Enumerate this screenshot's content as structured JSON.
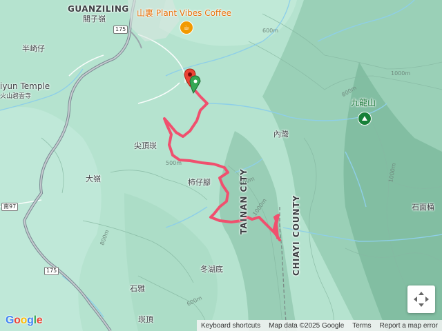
{
  "map": {
    "place_labels": [
      {
        "id": "guanziling-en",
        "text": "GUANZILING"
      },
      {
        "id": "guanziling-zh",
        "text": "關子嶺"
      },
      {
        "id": "banqizi",
        "text": "半崎仔"
      },
      {
        "id": "biyun-temple-en",
        "text": "iyun Temple"
      },
      {
        "id": "biyun-temple-zh",
        "text": "火山碧雲寺"
      },
      {
        "id": "jianding",
        "text": "尖頂崁"
      },
      {
        "id": "dalin",
        "text": "大嶺"
      },
      {
        "id": "shizijiao",
        "text": "柿仔腳"
      },
      {
        "id": "neiwan",
        "text": "內灣"
      },
      {
        "id": "donghudi",
        "text": "冬湖底"
      },
      {
        "id": "shiya",
        "text": "石雅"
      },
      {
        "id": "yiding",
        "text": "崁頂"
      },
      {
        "id": "shimianbu",
        "text": "石面桶"
      }
    ],
    "poi": {
      "name": "山裏 Plant Vibes Coffee",
      "icon": "coffee-cup-icon",
      "color": "#e8710a"
    },
    "peak": {
      "name": "九龍山",
      "icon": "hiking-peak-icon",
      "color": "#188038"
    },
    "counties": {
      "tainan": "TAINAN CITY",
      "chiayi": "CHIAYI COUNTY"
    },
    "road_shields": [
      "175",
      "南97",
      "175"
    ],
    "contour_labels": [
      "600m",
      "800m",
      "1000m",
      "500m",
      "1000m",
      "1000m",
      "600m",
      "600m",
      "800m"
    ],
    "track_color": "#f0506e",
    "start_marker_color": "#34a853",
    "end_marker_color": "#ea4335"
  },
  "footer": {
    "logo": "Google",
    "keyboard": "Keyboard shortcuts",
    "map_data": "Map data ©2025 Google",
    "terms": "Terms",
    "report": "Report a map error"
  },
  "controls": {
    "camera_icon": "camera-control-icon"
  }
}
